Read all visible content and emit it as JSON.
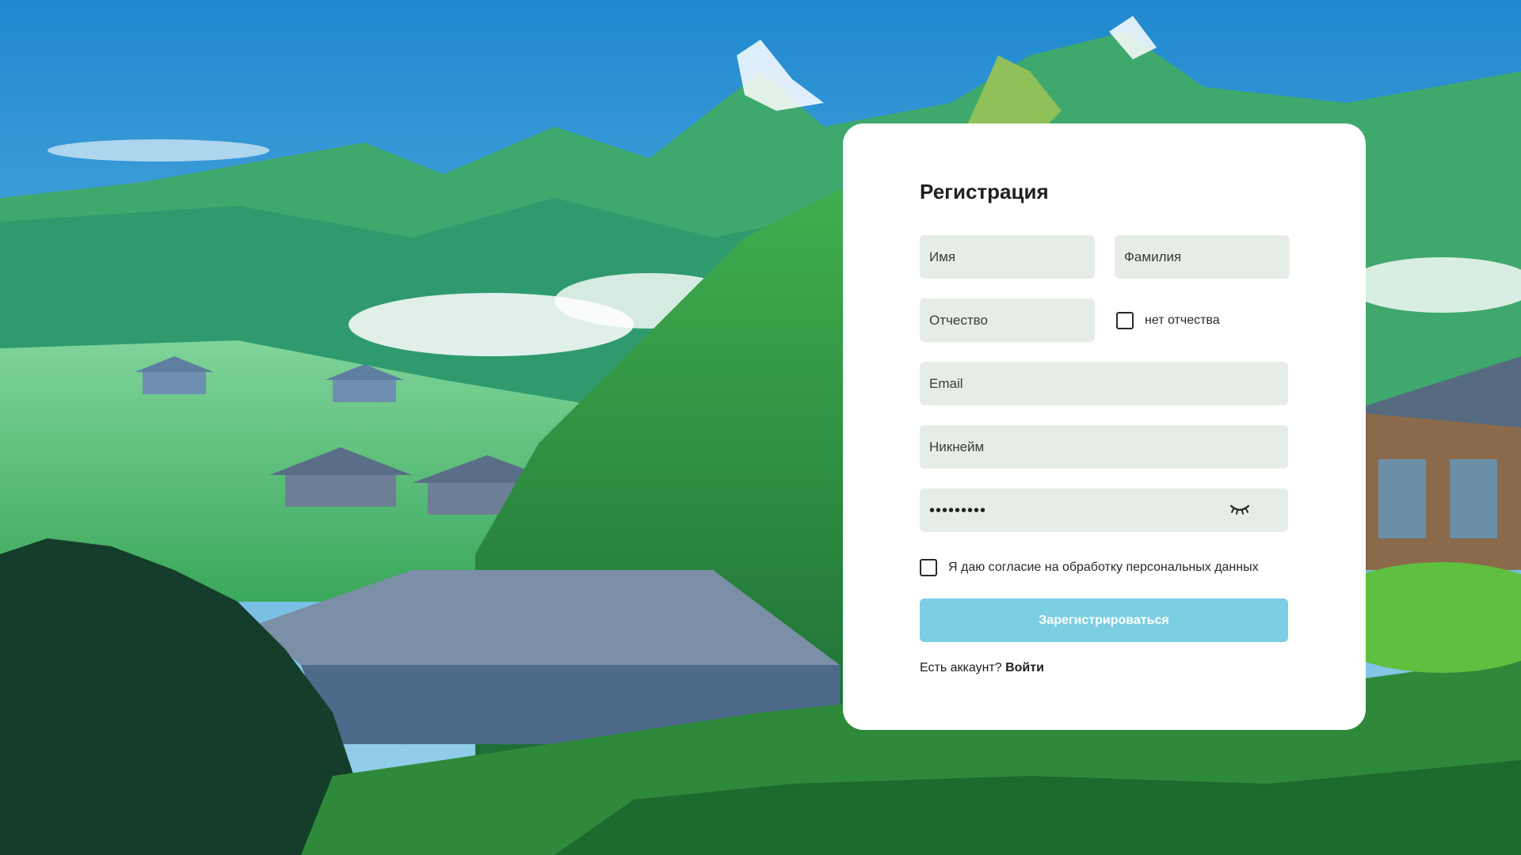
{
  "form": {
    "title": "Регистрация",
    "first_name_placeholder": "Имя",
    "last_name_placeholder": "Фамилия",
    "patronymic_placeholder": "Отчество",
    "no_patronymic_label": "нет отчества",
    "email_placeholder": "Email",
    "nickname_placeholder": "Никнейм",
    "password_value": "•••••••••",
    "password_toggle_icon": "eye-closed-icon",
    "consent_label": "Я даю согласие на обработку персональных данных",
    "submit_label": "Зарегистрироваться",
    "login_prompt": "Есть аккаунт?",
    "login_link": "Войти"
  },
  "colors": {
    "card_bg": "#ffffff",
    "input_bg": "#e6ede6",
    "submit_bg": "#7ccfe3",
    "text": "#1f1f24"
  }
}
